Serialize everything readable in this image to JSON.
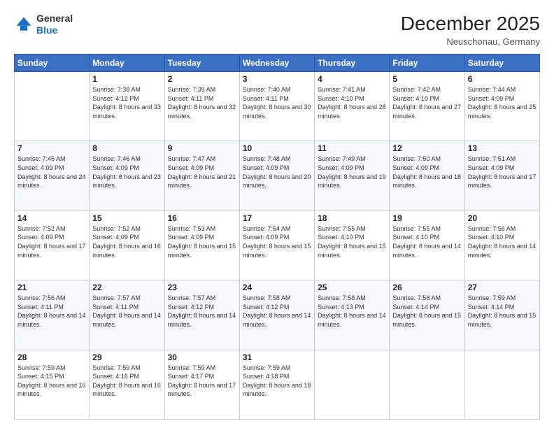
{
  "header": {
    "logo_line1": "General",
    "logo_line2": "Blue",
    "month": "December 2025",
    "location": "Neuschonau, Germany"
  },
  "weekdays": [
    "Sunday",
    "Monday",
    "Tuesday",
    "Wednesday",
    "Thursday",
    "Friday",
    "Saturday"
  ],
  "weeks": [
    [
      {
        "day": "",
        "sunrise": "",
        "sunset": "",
        "daylight": ""
      },
      {
        "day": "1",
        "sunrise": "Sunrise: 7:38 AM",
        "sunset": "Sunset: 4:12 PM",
        "daylight": "Daylight: 8 hours and 33 minutes."
      },
      {
        "day": "2",
        "sunrise": "Sunrise: 7:39 AM",
        "sunset": "Sunset: 4:11 PM",
        "daylight": "Daylight: 8 hours and 32 minutes."
      },
      {
        "day": "3",
        "sunrise": "Sunrise: 7:40 AM",
        "sunset": "Sunset: 4:11 PM",
        "daylight": "Daylight: 8 hours and 30 minutes."
      },
      {
        "day": "4",
        "sunrise": "Sunrise: 7:41 AM",
        "sunset": "Sunset: 4:10 PM",
        "daylight": "Daylight: 8 hours and 28 minutes."
      },
      {
        "day": "5",
        "sunrise": "Sunrise: 7:42 AM",
        "sunset": "Sunset: 4:10 PM",
        "daylight": "Daylight: 8 hours and 27 minutes."
      },
      {
        "day": "6",
        "sunrise": "Sunrise: 7:44 AM",
        "sunset": "Sunset: 4:09 PM",
        "daylight": "Daylight: 8 hours and 25 minutes."
      }
    ],
    [
      {
        "day": "7",
        "sunrise": "Sunrise: 7:45 AM",
        "sunset": "Sunset: 4:09 PM",
        "daylight": "Daylight: 8 hours and 24 minutes."
      },
      {
        "day": "8",
        "sunrise": "Sunrise: 7:46 AM",
        "sunset": "Sunset: 4:09 PM",
        "daylight": "Daylight: 8 hours and 23 minutes."
      },
      {
        "day": "9",
        "sunrise": "Sunrise: 7:47 AM",
        "sunset": "Sunset: 4:09 PM",
        "daylight": "Daylight: 8 hours and 21 minutes."
      },
      {
        "day": "10",
        "sunrise": "Sunrise: 7:48 AM",
        "sunset": "Sunset: 4:09 PM",
        "daylight": "Daylight: 8 hours and 20 minutes."
      },
      {
        "day": "11",
        "sunrise": "Sunrise: 7:49 AM",
        "sunset": "Sunset: 4:09 PM",
        "daylight": "Daylight: 8 hours and 19 minutes."
      },
      {
        "day": "12",
        "sunrise": "Sunrise: 7:50 AM",
        "sunset": "Sunset: 4:09 PM",
        "daylight": "Daylight: 8 hours and 18 minutes."
      },
      {
        "day": "13",
        "sunrise": "Sunrise: 7:51 AM",
        "sunset": "Sunset: 4:09 PM",
        "daylight": "Daylight: 8 hours and 17 minutes."
      }
    ],
    [
      {
        "day": "14",
        "sunrise": "Sunrise: 7:52 AM",
        "sunset": "Sunset: 4:09 PM",
        "daylight": "Daylight: 8 hours and 17 minutes."
      },
      {
        "day": "15",
        "sunrise": "Sunrise: 7:52 AM",
        "sunset": "Sunset: 4:09 PM",
        "daylight": "Daylight: 8 hours and 16 minutes."
      },
      {
        "day": "16",
        "sunrise": "Sunrise: 7:53 AM",
        "sunset": "Sunset: 4:09 PM",
        "daylight": "Daylight: 8 hours and 15 minutes."
      },
      {
        "day": "17",
        "sunrise": "Sunrise: 7:54 AM",
        "sunset": "Sunset: 4:09 PM",
        "daylight": "Daylight: 8 hours and 15 minutes."
      },
      {
        "day": "18",
        "sunrise": "Sunrise: 7:55 AM",
        "sunset": "Sunset: 4:10 PM",
        "daylight": "Daylight: 8 hours and 15 minutes."
      },
      {
        "day": "19",
        "sunrise": "Sunrise: 7:55 AM",
        "sunset": "Sunset: 4:10 PM",
        "daylight": "Daylight: 8 hours and 14 minutes."
      },
      {
        "day": "20",
        "sunrise": "Sunrise: 7:56 AM",
        "sunset": "Sunset: 4:10 PM",
        "daylight": "Daylight: 8 hours and 14 minutes."
      }
    ],
    [
      {
        "day": "21",
        "sunrise": "Sunrise: 7:56 AM",
        "sunset": "Sunset: 4:11 PM",
        "daylight": "Daylight: 8 hours and 14 minutes."
      },
      {
        "day": "22",
        "sunrise": "Sunrise: 7:57 AM",
        "sunset": "Sunset: 4:11 PM",
        "daylight": "Daylight: 8 hours and 14 minutes."
      },
      {
        "day": "23",
        "sunrise": "Sunrise: 7:57 AM",
        "sunset": "Sunset: 4:12 PM",
        "daylight": "Daylight: 8 hours and 14 minutes."
      },
      {
        "day": "24",
        "sunrise": "Sunrise: 7:58 AM",
        "sunset": "Sunset: 4:12 PM",
        "daylight": "Daylight: 8 hours and 14 minutes."
      },
      {
        "day": "25",
        "sunrise": "Sunrise: 7:58 AM",
        "sunset": "Sunset: 4:13 PM",
        "daylight": "Daylight: 8 hours and 14 minutes."
      },
      {
        "day": "26",
        "sunrise": "Sunrise: 7:58 AM",
        "sunset": "Sunset: 4:14 PM",
        "daylight": "Daylight: 8 hours and 15 minutes."
      },
      {
        "day": "27",
        "sunrise": "Sunrise: 7:59 AM",
        "sunset": "Sunset: 4:14 PM",
        "daylight": "Daylight: 8 hours and 15 minutes."
      }
    ],
    [
      {
        "day": "28",
        "sunrise": "Sunrise: 7:59 AM",
        "sunset": "Sunset: 4:15 PM",
        "daylight": "Daylight: 8 hours and 16 minutes."
      },
      {
        "day": "29",
        "sunrise": "Sunrise: 7:59 AM",
        "sunset": "Sunset: 4:16 PM",
        "daylight": "Daylight: 8 hours and 16 minutes."
      },
      {
        "day": "30",
        "sunrise": "Sunrise: 7:59 AM",
        "sunset": "Sunset: 4:17 PM",
        "daylight": "Daylight: 8 hours and 17 minutes."
      },
      {
        "day": "31",
        "sunrise": "Sunrise: 7:59 AM",
        "sunset": "Sunset: 4:18 PM",
        "daylight": "Daylight: 8 hours and 18 minutes."
      },
      {
        "day": "",
        "sunrise": "",
        "sunset": "",
        "daylight": ""
      },
      {
        "day": "",
        "sunrise": "",
        "sunset": "",
        "daylight": ""
      },
      {
        "day": "",
        "sunrise": "",
        "sunset": "",
        "daylight": ""
      }
    ]
  ]
}
